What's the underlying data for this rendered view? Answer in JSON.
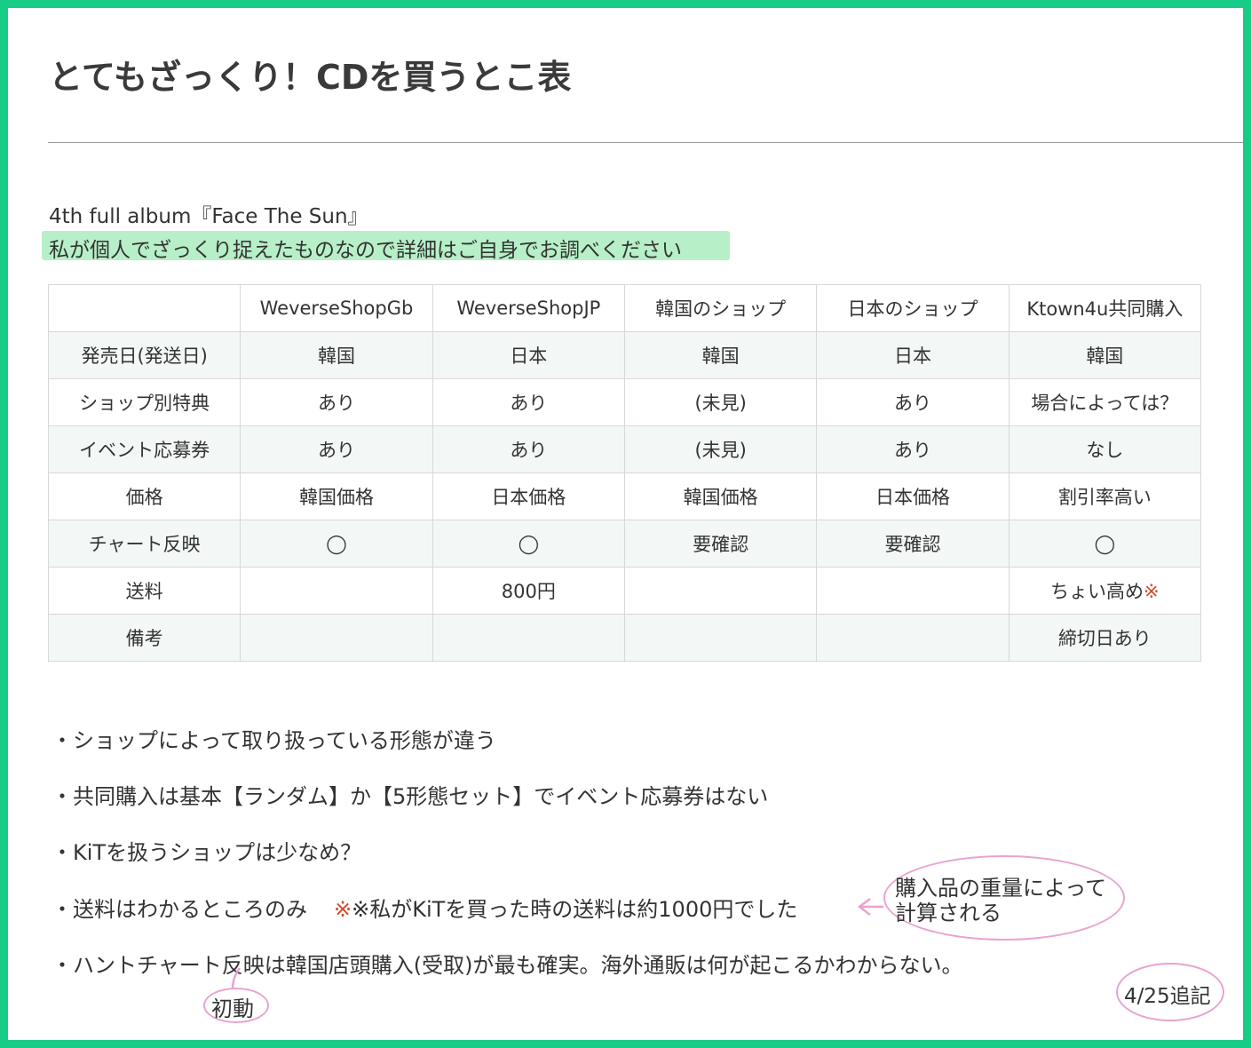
{
  "page": {
    "title": "とてもざっくり！CDを買うとこ表",
    "subtitle": "4th full album『Face The Sun』",
    "note": "私が個人でざっくり捉えたものなので詳細はご自身でお調べください"
  },
  "table": {
    "headers": [
      "",
      "WeverseShopGb",
      "WeverseShopJP",
      "韓国のショップ",
      "日本のショップ",
      "Ktown4u共同購入"
    ],
    "rows": [
      [
        "発売日(発送日)",
        "韓国",
        "日本",
        "韓国",
        "日本",
        "韓国"
      ],
      [
        "ショップ別特典",
        "あり",
        "あり",
        "(未見)",
        "あり",
        "場合によっては？"
      ],
      [
        "イベント応募券",
        "あり",
        "あり",
        "(未見)",
        "あり",
        "なし"
      ],
      [
        "価格",
        "韓国価格",
        "日本価格",
        "韓国価格",
        "日本価格",
        "割引率高い"
      ],
      [
        "チャート反映",
        "◯",
        "◯",
        "要確認",
        "要確認",
        "◯"
      ],
      [
        "送料",
        "",
        "800円",
        "",
        "",
        "ちょい高め"
      ],
      [
        "備考",
        "",
        "",
        "",
        "",
        "締切日あり"
      ]
    ],
    "shipping_mark": "※"
  },
  "bullets": {
    "b1": "・ショップによって取り扱っている形態が違う",
    "b2": "・共同購入は基本【ランダム】か【5形態セット】でイベント応募券はない",
    "b3": "・KiTを扱うショップは少なめ？",
    "b4_main": "・送料はわかるところのみ",
    "b4_note": "※私がKiTを買った時の送料は約1000円でした",
    "b5": "・ハントチャート反映は韓国店頭購入(受取)が最も確実。海外通販は何が起こるかわからない。"
  },
  "annotations": {
    "weight_line1": "購入品の重量によって",
    "weight_line2": "計算される",
    "first_week": "初動",
    "added_date": "4/25追記"
  },
  "colors": {
    "frame": "#16cc86",
    "highlight": "#b7f0c8",
    "annotation": "#e9a3d0",
    "note_red": "#d24a2a"
  }
}
